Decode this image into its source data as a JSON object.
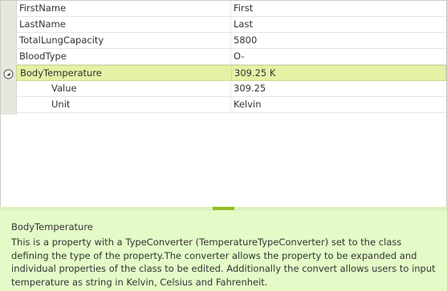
{
  "properties": [
    {
      "name": "FirstName",
      "value": "First"
    },
    {
      "name": "LastName",
      "value": "Last"
    },
    {
      "name": "TotalLungCapacity",
      "value": "5800"
    },
    {
      "name": "BloodType",
      "value": "O-"
    },
    {
      "name": "BodyTemperature",
      "value": "309.25 K",
      "selected": true,
      "expanded": true,
      "children": [
        {
          "name": "Value",
          "value": "309.25"
        },
        {
          "name": "Unit",
          "value": "Kelvin"
        }
      ]
    }
  ],
  "description": {
    "title": "BodyTemperature",
    "text": "This is a property with a TypeConverter (TemperatureTypeConverter) set to the class defining the type of the property.The converter allows the property to be expanded and individual properties of the class to be edited. Additionally the convert allows users to input temperature as string in Kelvin, Celsius and Fahrenheit."
  },
  "colors": {
    "selected_row": "#e6f1a6",
    "description_bg": "#e4fbc8",
    "splitter_grip": "#8fbf1e"
  },
  "icons": {
    "expander": "collapse-circle-icon"
  }
}
